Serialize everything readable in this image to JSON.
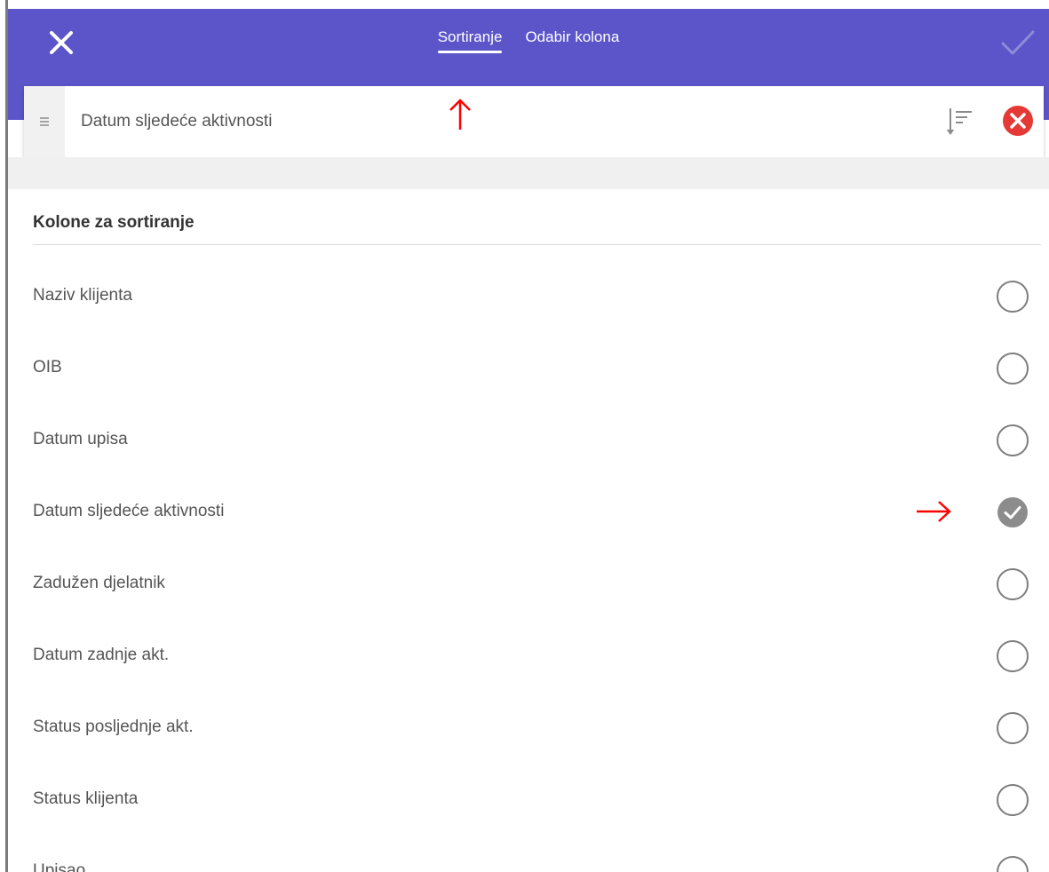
{
  "header": {
    "tabs": [
      {
        "label": "Sortiranje",
        "active": true
      },
      {
        "label": "Odabir kolona",
        "active": false
      }
    ],
    "close_icon": "close-icon",
    "confirm_icon": "check-icon",
    "background_color": "#5b55c9"
  },
  "selected_sort": {
    "label": "Datum sljedeće aktivnosti",
    "direction_icon": "sort-descending-icon",
    "remove_icon": "remove-circle-icon",
    "remove_color": "#e53935"
  },
  "section": {
    "title": "Kolone za sortiranje"
  },
  "columns": [
    {
      "label": "Naziv klijenta",
      "selected": false
    },
    {
      "label": "OIB",
      "selected": false
    },
    {
      "label": "Datum upisa",
      "selected": false
    },
    {
      "label": "Datum sljedeće aktivnosti",
      "selected": true
    },
    {
      "label": "Zadužen djelatnik",
      "selected": false
    },
    {
      "label": "Datum zadnje akt.",
      "selected": false
    },
    {
      "label": "Status posljednje akt.",
      "selected": false
    },
    {
      "label": "Status klijenta",
      "selected": false
    },
    {
      "label": "Upisao",
      "selected": false
    }
  ],
  "annotation_color": "#ff0000"
}
